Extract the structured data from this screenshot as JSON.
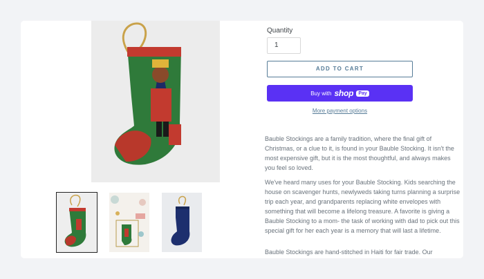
{
  "product": {
    "quantity_label": "Quantity",
    "quantity_value": "1",
    "add_to_cart": "ADD TO CART",
    "buy_with": "Buy with",
    "shop_word": "shop",
    "pay_word": "Pay",
    "more_payment": "More payment options"
  },
  "description": {
    "p1": "Bauble Stockings are a family tradition, where the final gift of Christmas, or a clue to it, is found in your Bauble Stocking. It isn't the most expensive gift, but it is the most thoughtful, and always makes you feel so loved.",
    "p2": "We've heard many uses for your Bauble Stocking. Kids searching the house on scavenger hunts, newlyweds taking turns planning a surprise trip each year, and grandparents replacing white envelopes with something that will become a lifelong treasure. A favorite is giving a Bauble Stocking to a mom- the task of working with dad to pick out this special gift for her each year is a memory that will last a lifetime.",
    "p3": "Bauble Stockings are hand-stitched in Haiti for fair trade. Our"
  },
  "colors": {
    "accent": "#557b97",
    "shop_pay": "#5a31f4",
    "text": "#69727b"
  },
  "images": {
    "main": "nutcracker-stocking-image",
    "thumbs": [
      "nutcracker-stocking-thumb",
      "gift-flatlay-thumb",
      "navy-velvet-stocking-thumb"
    ]
  }
}
